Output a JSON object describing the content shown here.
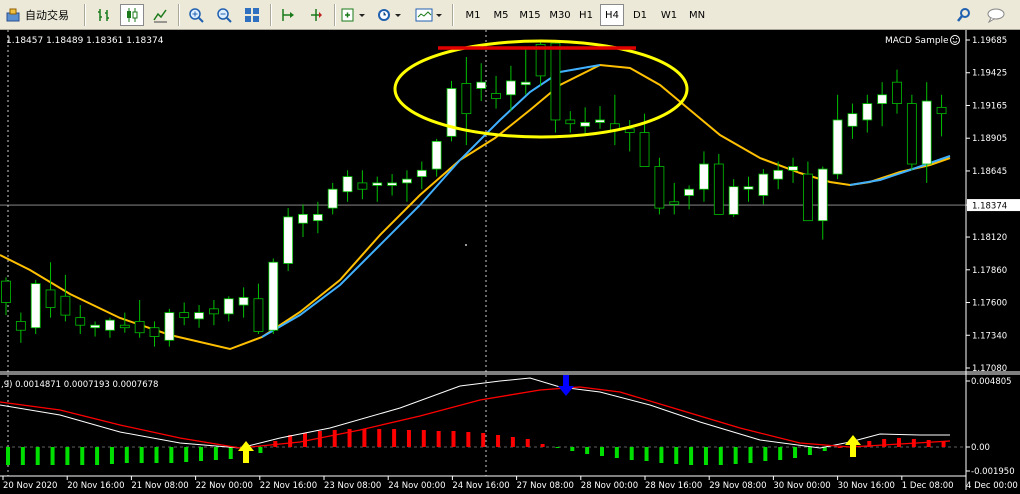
{
  "toolbar": {
    "autotrading_label": "自动交易",
    "timeframes": [
      "M1",
      "M5",
      "M15",
      "M30",
      "H1",
      "H4",
      "D1",
      "W1",
      "MN"
    ],
    "active_timeframe": "H4",
    "icons": [
      "bar-chart-icon",
      "candle-chart-icon",
      "line-chart-icon",
      "zoom-in-icon",
      "zoom-out-icon",
      "tile-windows-icon",
      "autoscroll-icon",
      "chart-shift-icon",
      "add-indicator-icon",
      "period-icon",
      "template-icon",
      "search-icon",
      "chat-icon"
    ]
  },
  "chart": {
    "ohlc_readout": "1.18457 1.18489 1.18361 1.18374",
    "expert_label": "MACD Sample",
    "current_price_label": "1.18374",
    "price_ticks": [
      "1.19685",
      "1.19425",
      "1.19165",
      "1.18905",
      "1.18645",
      "1.18374",
      "1.18120",
      "1.17860",
      "1.17600",
      "1.17340",
      "1.17080"
    ],
    "time_ticks": [
      "20 Nov 2020",
      "20 Nov 16:00",
      "21 Nov 08:00",
      "22 Nov 00:00",
      "22 Nov 16:00",
      "23 Nov 08:00",
      "24 Nov 00:00",
      "24 Nov 16:00",
      "27 Nov 08:00",
      "28 Nov 00:00",
      "28 Nov 16:00",
      "29 Nov 08:00",
      "30 Nov 00:00",
      "30 Nov 16:00",
      "1 Dec 08:00",
      "4 Dec 00:00"
    ],
    "macd_readout": ",9) 0.0014871 0.0007193 0.0007678",
    "macd_ticks": [
      "0.004805",
      "0.00",
      "-0.001950"
    ],
    "colors": {
      "background": "#000000",
      "bull_candle": "#ffffff",
      "wick": "#00c000",
      "ma_slow": "#ffc000",
      "ma_fast": "#40b0ff",
      "highlight_ellipse": "#ffff00",
      "resistance_line": "#e00000",
      "macd_line": "#ffffff",
      "signal_line": "#ff0000",
      "hist_pos": "#ff0000",
      "hist_neg": "#00e000",
      "arrow_buy": "#ffff00",
      "arrow_sell": "#0000ff"
    }
  }
}
